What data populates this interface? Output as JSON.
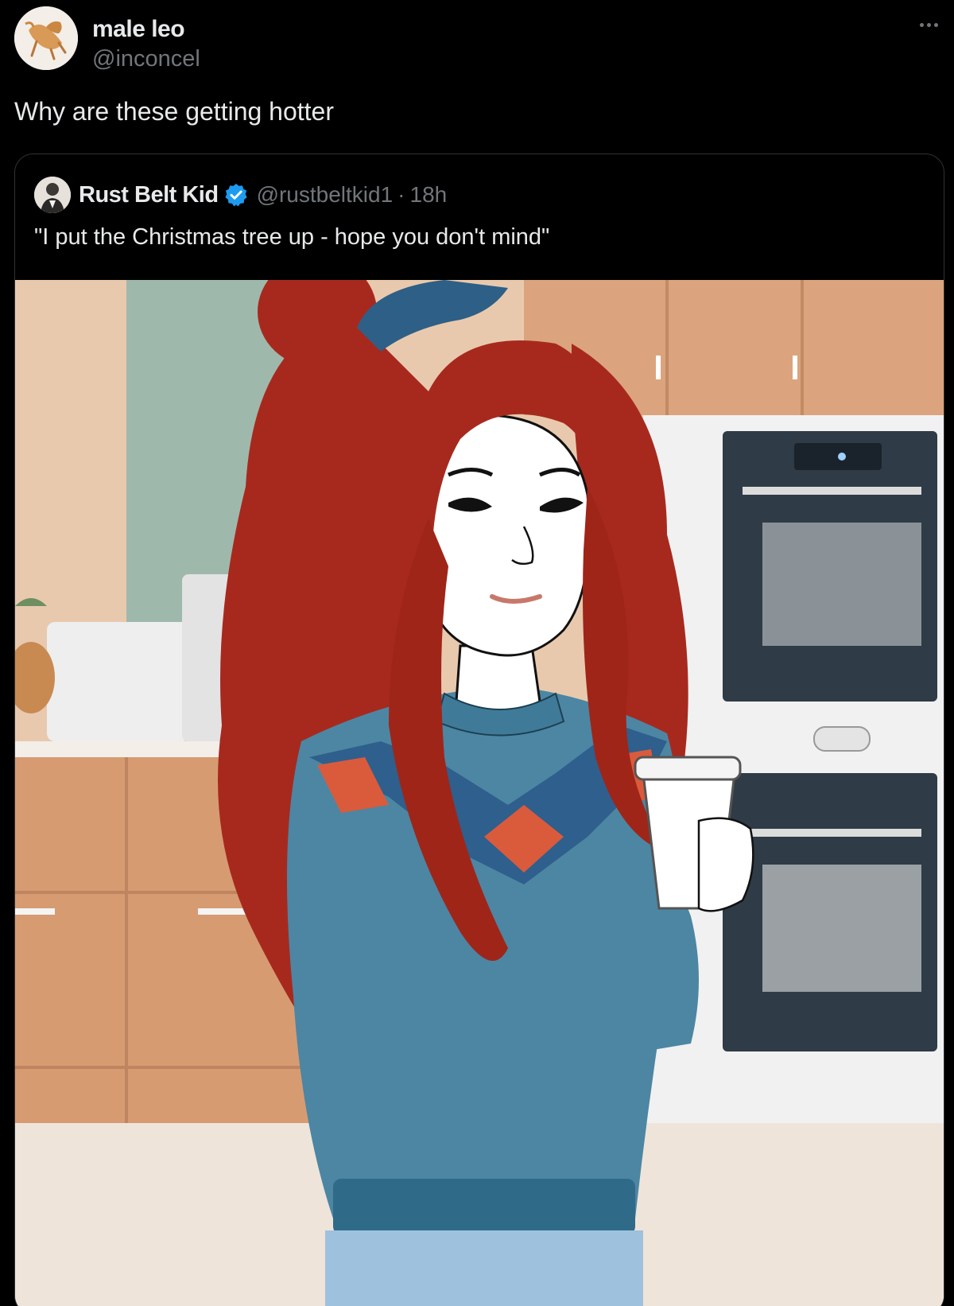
{
  "post": {
    "display_name": "male leo",
    "handle": "@inconcel",
    "text": "Why are these getting hotter",
    "avatar_icon": "lion-figure-avatar",
    "more_icon": "more-options-icon"
  },
  "quoted_post": {
    "display_name": "Rust Belt Kid",
    "verified": true,
    "handle": "@rustbeltkid1",
    "separator": "·",
    "timestamp": "18h",
    "text": "\"I put the Christmas tree up - hope you don't mind\"",
    "avatar_icon": "person-portrait-avatar",
    "media_icon": "illustration-woman-red-hair-christmas-sweater-coffee-kitchen"
  },
  "colors": {
    "background": "#000000",
    "primary_text": "#e7e9ea",
    "secondary_text": "#71767b",
    "border": "#2f3336",
    "verified_blue": "#1d9bf0"
  }
}
